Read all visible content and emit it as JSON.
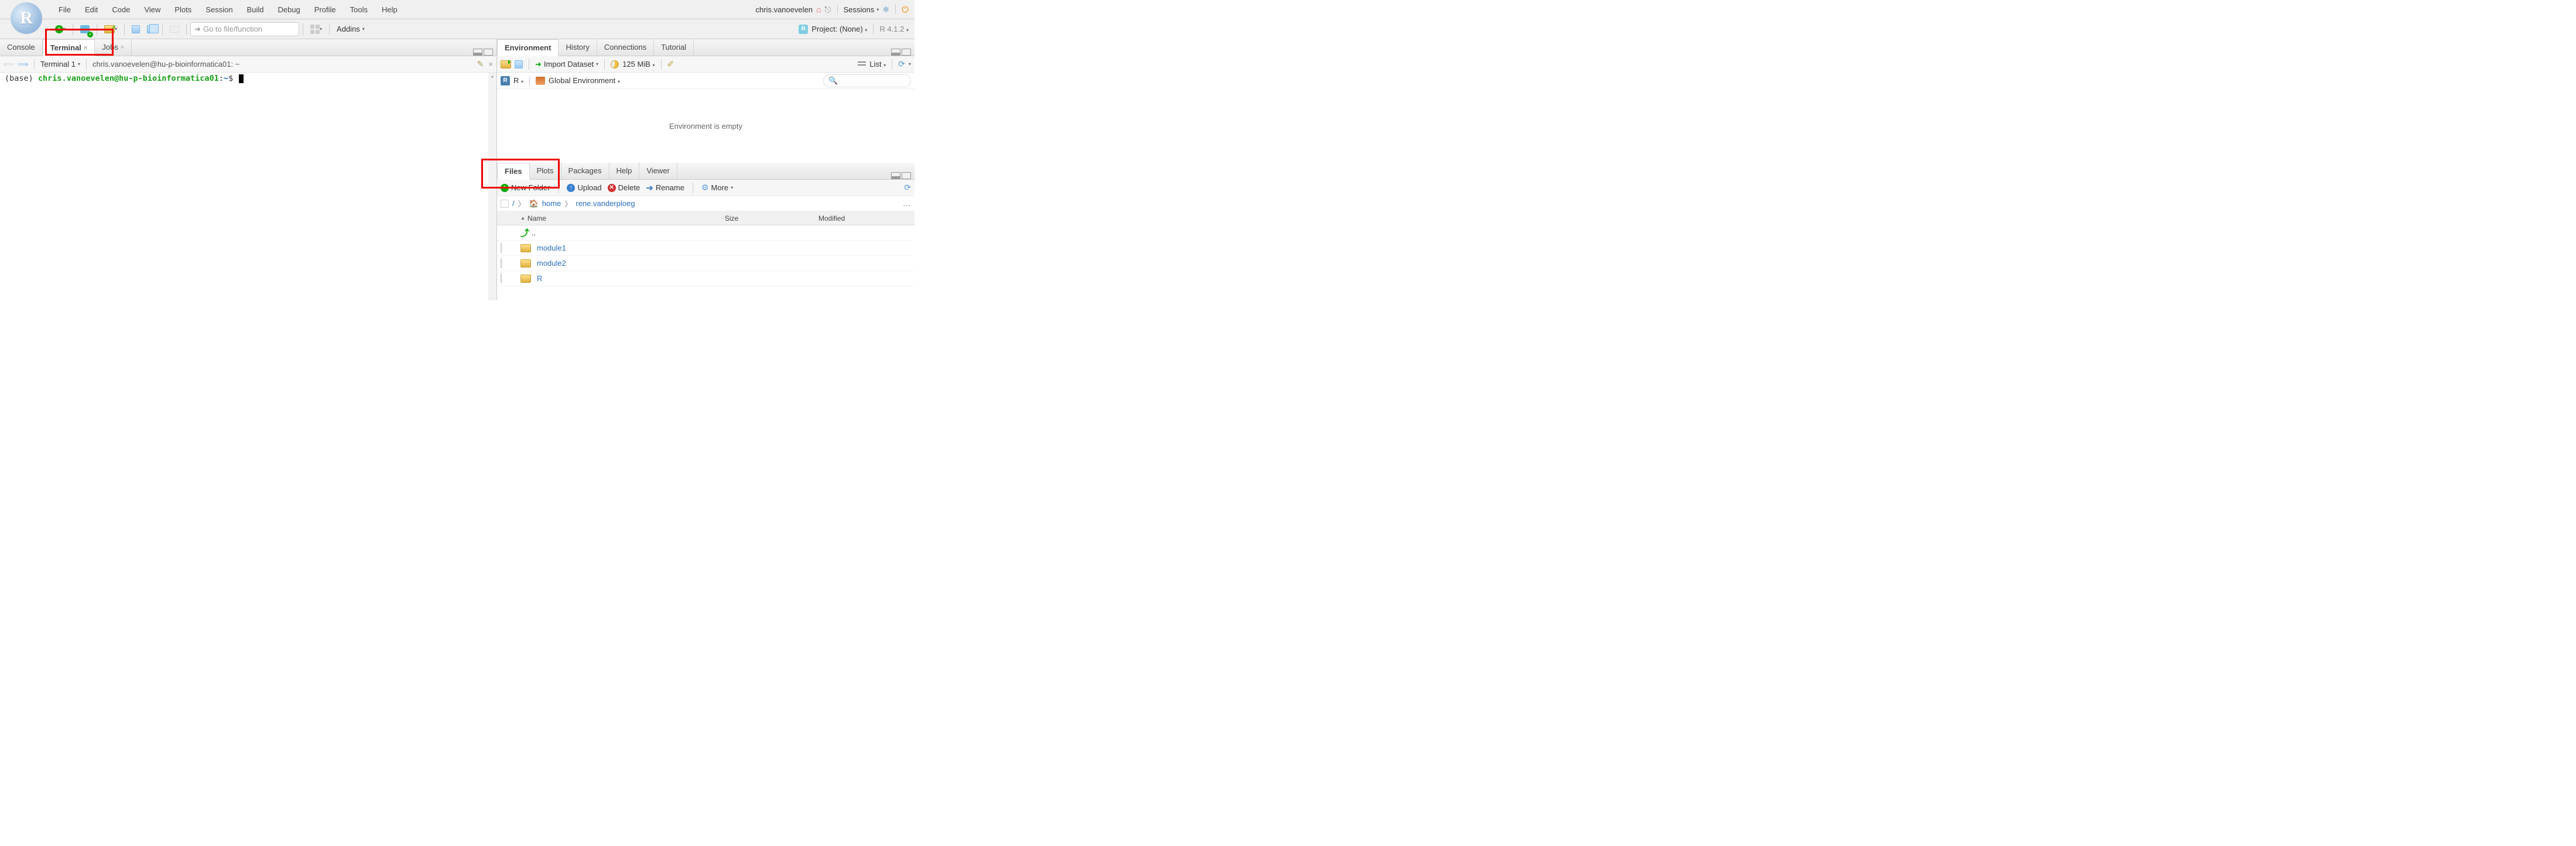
{
  "menu": {
    "items": [
      "File",
      "Edit",
      "Code",
      "View",
      "Plots",
      "Session",
      "Build",
      "Debug",
      "Profile",
      "Tools",
      "Help"
    ]
  },
  "user": {
    "name": "chris.vanoevelen",
    "sessions_label": "Sessions"
  },
  "toolbar": {
    "goto_placeholder": "Go to file/function",
    "addins_label": "Addins"
  },
  "project": {
    "label": "Project: (None)",
    "r_version": "R 4.1.2"
  },
  "left": {
    "tabs": [
      "Console",
      "Terminal",
      "Jobs"
    ],
    "active_tab": 1,
    "terminal_selector": "Terminal 1",
    "path": "chris.vanoevelen@hu-p-bioinformatica01: ~",
    "prompt": {
      "base": "(base)",
      "host": "chris.vanoevelen@hu-p-bioinformatica01",
      "colon": ":",
      "tilde": "~",
      "dollar": "$"
    }
  },
  "env_tabs": [
    "Environment",
    "History",
    "Connections",
    "Tutorial"
  ],
  "env": {
    "import_label": "Import Dataset",
    "memory": "125 MiB",
    "list_label": "List",
    "scope_label_r": "R",
    "scope_label_global": "Global Environment",
    "empty_text": "Environment is empty"
  },
  "files_tabs": [
    "Files",
    "Plots",
    "Packages",
    "Help",
    "Viewer"
  ],
  "files": {
    "new_folder": "New Folder",
    "upload": "Upload",
    "delete": "Delete",
    "rename": "Rename",
    "more": "More",
    "breadcrumb": {
      "root": "/",
      "home": "home",
      "user": "rene.vanderploeg"
    },
    "cols": {
      "name": "Name",
      "size": "Size",
      "modified": "Modified"
    },
    "up_label": "..",
    "rows": [
      {
        "name": "module1"
      },
      {
        "name": "module2"
      },
      {
        "name": "R"
      }
    ]
  }
}
